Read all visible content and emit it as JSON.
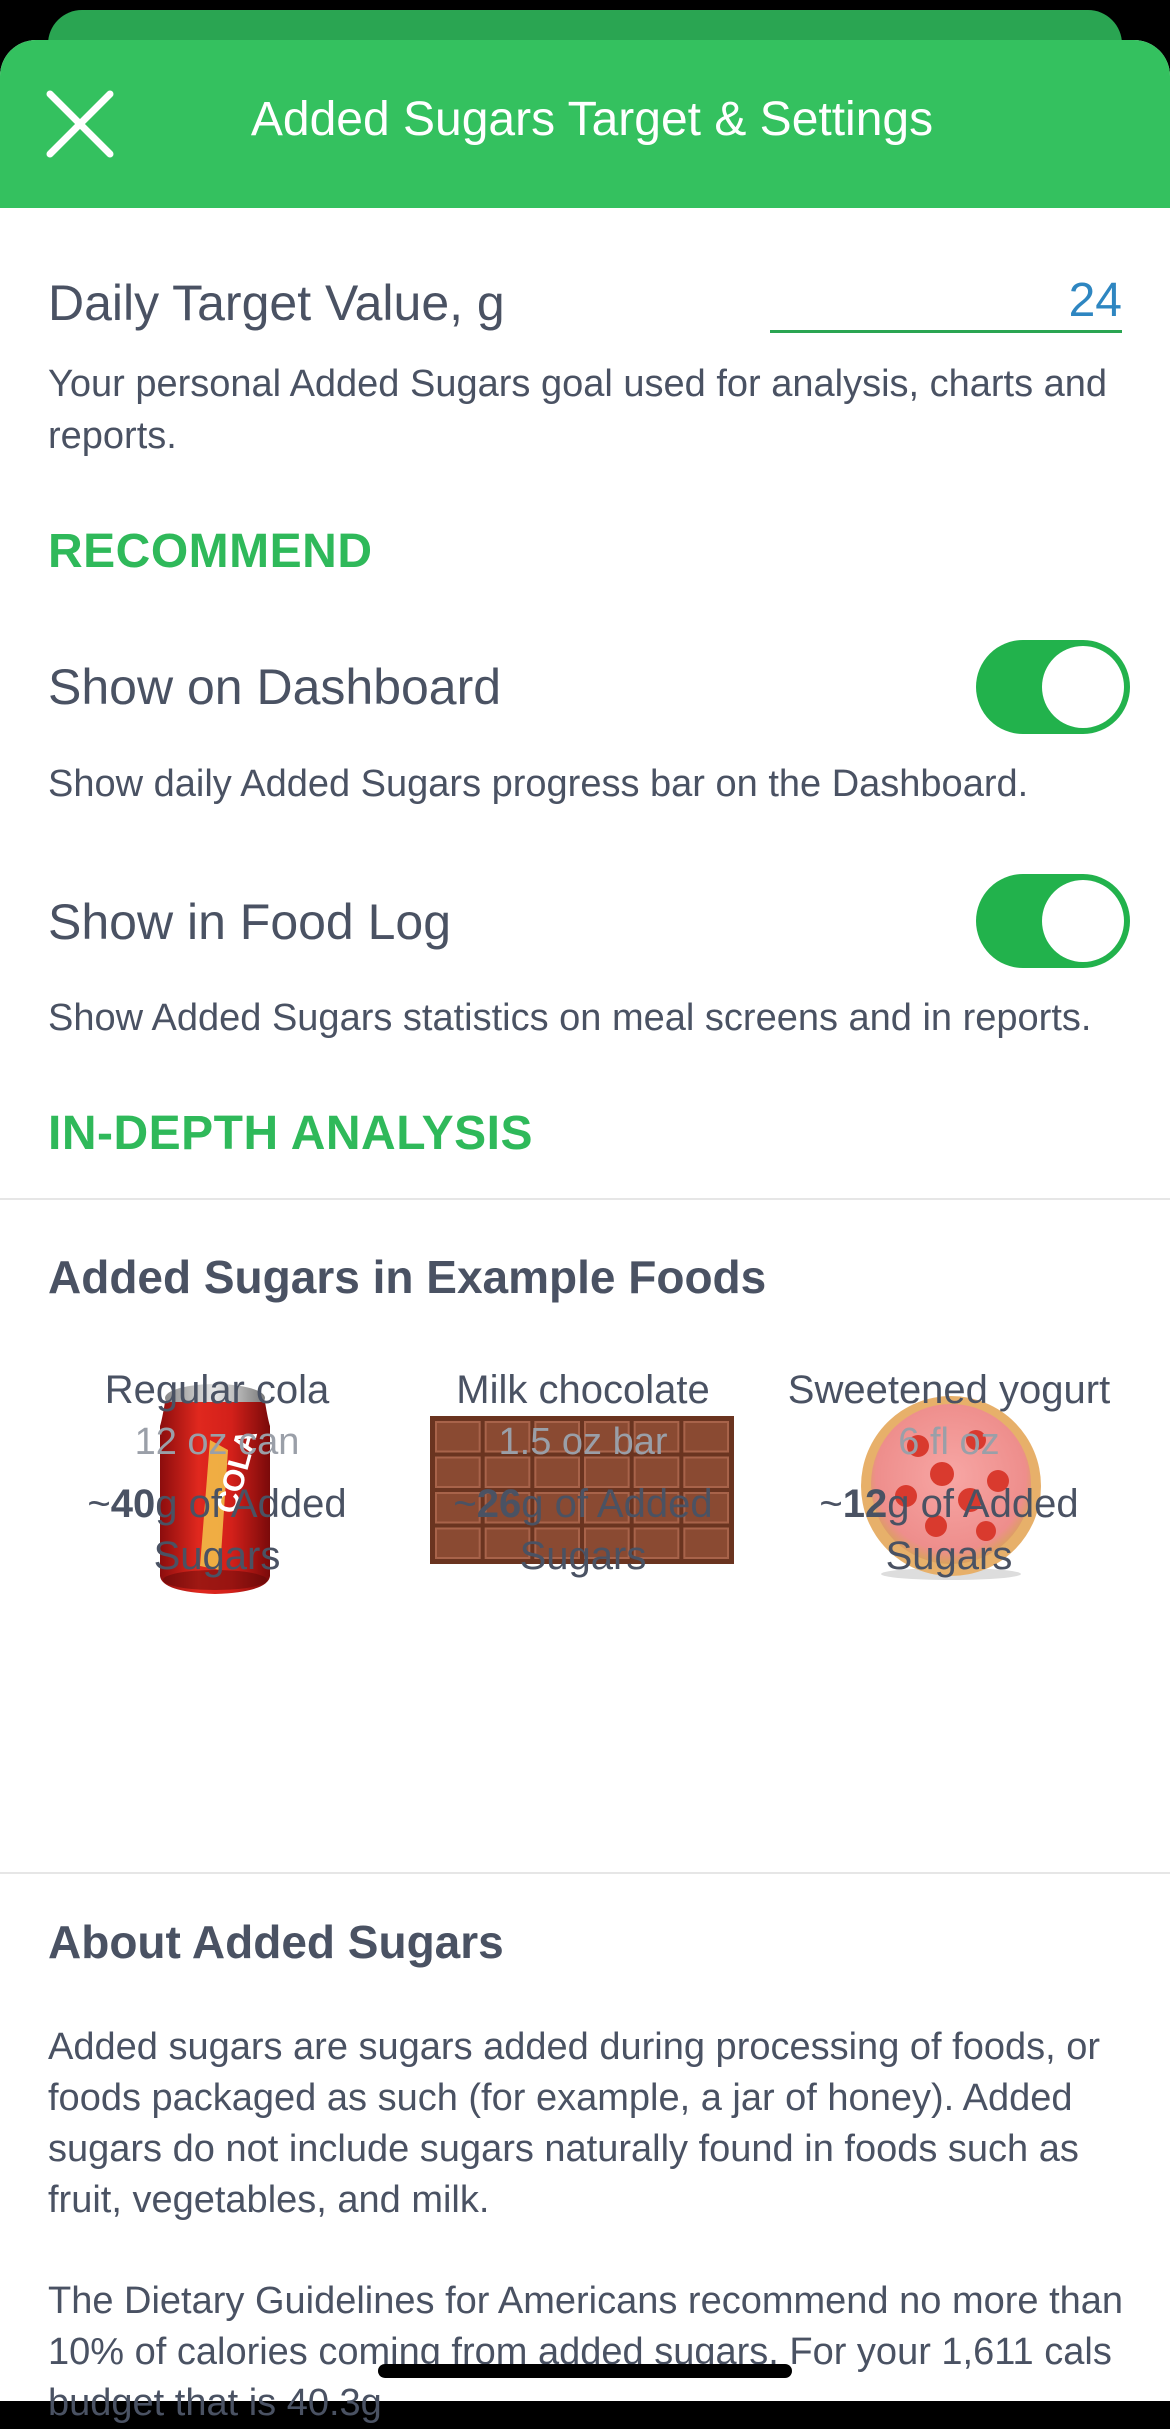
{
  "header": {
    "title": "Added Sugars Target & Settings",
    "close_icon": "close-icon"
  },
  "daily_target": {
    "label": "Daily Target Value, g",
    "value": "24",
    "description": "Your personal Added Sugars goal used for analysis, charts and reports."
  },
  "recommend": {
    "heading": "RECOMMEND",
    "show_on_dashboard": {
      "label": "Show on Dashboard",
      "enabled": true,
      "description": "Show daily Added Sugars progress bar on the Dashboard."
    },
    "show_in_food_log": {
      "label": "Show in Food Log",
      "enabled": true,
      "description": "Show Added Sugars statistics on meal screens and in reports."
    }
  },
  "in_depth": {
    "heading": "IN-DEPTH ANALYSIS"
  },
  "examples": {
    "title": "Added Sugars in Example Foods",
    "items": [
      {
        "name": "Regular cola",
        "size": "12 oz can",
        "prefix": "~",
        "grams": "40",
        "suffix": "g of Added Sugars",
        "image": "cola-can-image",
        "can_text": "COLA"
      },
      {
        "name": "Milk chocolate",
        "size": "1.5 oz bar",
        "prefix": "~",
        "grams": "26",
        "suffix": "g of Added Sugars",
        "image": "chocolate-bar-image"
      },
      {
        "name": "Sweetened yogurt",
        "size": "6 fl oz",
        "prefix": "~",
        "grams": "12",
        "suffix": "g of Added Sugars",
        "image": "yogurt-bowl-image"
      }
    ]
  },
  "about": {
    "title": "About Added Sugars",
    "paragraph1": "Added sugars are sugars added during processing of foods, or foods packaged as such (for example, a jar of honey). Added sugars do not include sugars naturally found in foods such as fruit, vegetables, and milk.",
    "paragraph2": "The Dietary Guidelines for Americans recommend no more than 10% of calories coming from added sugars. For your 1,611 cals budget that is 40.3g"
  },
  "colors": {
    "header_green": "#34c15f",
    "accent_green": "#2fb95a",
    "toggle_green": "#22b24c",
    "value_blue": "#2e86c1"
  }
}
